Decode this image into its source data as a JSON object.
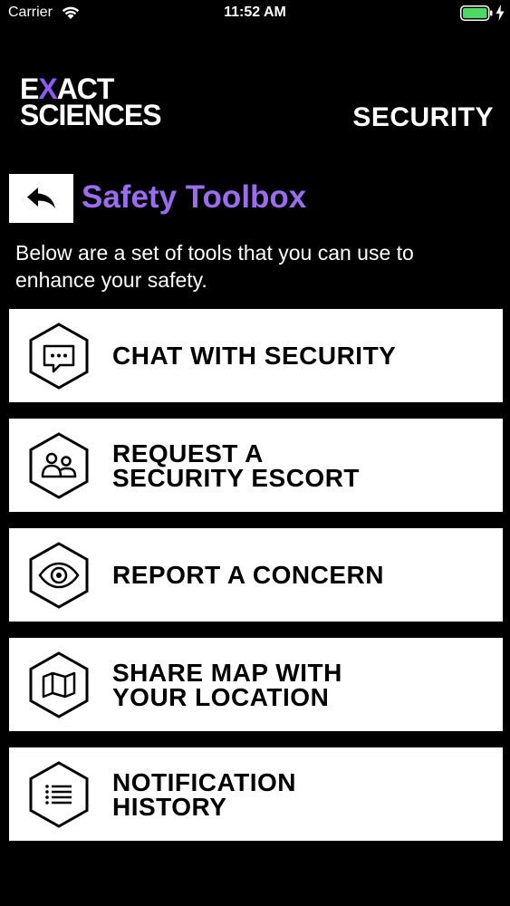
{
  "status_bar": {
    "carrier": "Carrier",
    "time": "11:52 AM",
    "battery_color": "#4cd964"
  },
  "header": {
    "logo_line1_prefix": "E",
    "logo_line1_x": "X",
    "logo_line1_suffix": "ACT",
    "logo_line2": "SCIENCES",
    "section_title": "SECURITY",
    "accent_color": "#8b5cf6"
  },
  "page": {
    "back_icon": "back-arrow-icon",
    "title": "Safety Toolbox",
    "description": "Below are a set of tools that you can use to enhance your safety."
  },
  "tools": [
    {
      "label": "CHAT WITH SECURITY",
      "icon": "chat-icon"
    },
    {
      "label": "REQUEST A\nSECURITY ESCORT",
      "icon": "people-icon"
    },
    {
      "label": "REPORT A CONCERN",
      "icon": "eye-icon"
    },
    {
      "label": "SHARE MAP WITH\nYOUR LOCATION",
      "icon": "map-icon"
    },
    {
      "label": "NOTIFICATION\nHISTORY",
      "icon": "list-icon"
    }
  ]
}
